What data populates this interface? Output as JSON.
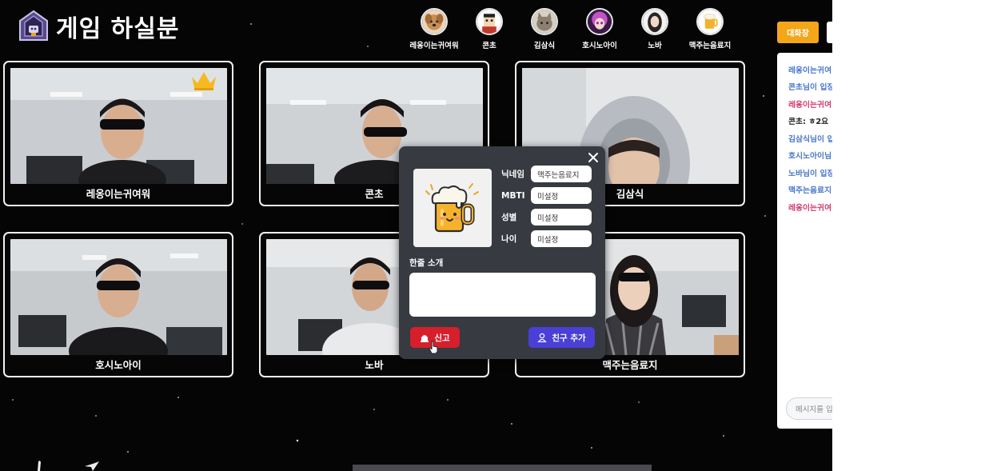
{
  "header": {
    "title": "게임 하실분",
    "players": [
      {
        "name": "레옹이는귀여워",
        "avatar": "dog-avatar",
        "color": "#d9a877"
      },
      {
        "name": "콘초",
        "avatar": "pixel-character-avatar",
        "color": "#e8e2d6"
      },
      {
        "name": "김삼식",
        "avatar": "cat-avatar",
        "color": "#b8ad9c"
      },
      {
        "name": "호시노아이",
        "avatar": "anime-girl-avatar",
        "color": "#b040b0"
      },
      {
        "name": "노바",
        "avatar": "girl-avatar",
        "color": "#ddd"
      },
      {
        "name": "맥주는음료지",
        "avatar": "beer-avatar",
        "color": "#f6b52c"
      }
    ]
  },
  "videos": [
    {
      "name": "레옹이는귀여워",
      "host": true
    },
    {
      "name": "콘초",
      "host": false
    },
    {
      "name": "김삼식",
      "host": false
    },
    {
      "name": "호시노아이",
      "host": false
    },
    {
      "name": "노바",
      "host": false
    },
    {
      "name": "맥주는음료지",
      "host": false
    }
  ],
  "profile_modal": {
    "image": "beer-mug-icon",
    "fields": [
      {
        "label": "닉네임",
        "value": "맥주는음료지"
      },
      {
        "label": "MBTI",
        "value": "미설정"
      },
      {
        "label": "성별",
        "value": "미설정"
      },
      {
        "label": "나이",
        "value": "미설정"
      }
    ],
    "intro_label": "한줄 소개",
    "intro_value": "",
    "report_label": "신고",
    "friend_label": "친구 추가"
  },
  "chat": {
    "tab_label": "대화창",
    "messages": [
      {
        "text": "레옹이는귀여",
        "color": "#4a76c9"
      },
      {
        "text": "콘초님이 입장",
        "color": "#4a76c9"
      },
      {
        "text": "레옹이는귀여",
        "color": "#d23a6e"
      },
      {
        "text": "콘초: ㅎ2요",
        "color": "#222222"
      },
      {
        "text": "김삼식님이 입",
        "color": "#4a76c9"
      },
      {
        "text": "호시노아이님",
        "color": "#4a76c9"
      },
      {
        "text": "노바님이 입장",
        "color": "#4a76c9"
      },
      {
        "text": "맥주는음료지",
        "color": "#4a76c9"
      },
      {
        "text": "레옹이는귀여",
        "color": "#d23a6e"
      }
    ],
    "input_placeholder": "메시지를 입"
  },
  "colors": {
    "accent": "#f3a617",
    "report": "#d61f2b",
    "friend": "#4a3fd6",
    "modal_bg": "#373a41"
  }
}
